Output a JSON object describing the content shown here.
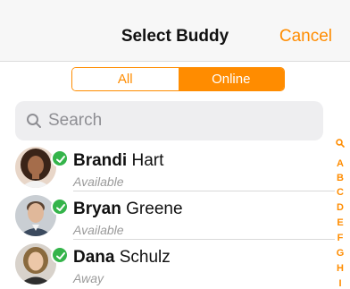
{
  "nav": {
    "title": "Select Buddy",
    "cancel_label": "Cancel"
  },
  "segments": {
    "all": "All",
    "online": "Online",
    "selected": "Online"
  },
  "search": {
    "placeholder": "Search",
    "value": ""
  },
  "contacts": [
    {
      "first": "Brandi",
      "last": "Hart",
      "status": "Available",
      "presence": "online"
    },
    {
      "first": "Bryan",
      "last": "Greene",
      "status": "Available",
      "presence": "online"
    },
    {
      "first": "Dana",
      "last": "Schulz",
      "status": "Away",
      "presence": "online"
    }
  ],
  "index_letters": [
    "A",
    "B",
    "C",
    "D",
    "E",
    "F",
    "G",
    "H",
    "I"
  ],
  "colors": {
    "accent": "#ff8c00",
    "presence": "#34b44a"
  }
}
